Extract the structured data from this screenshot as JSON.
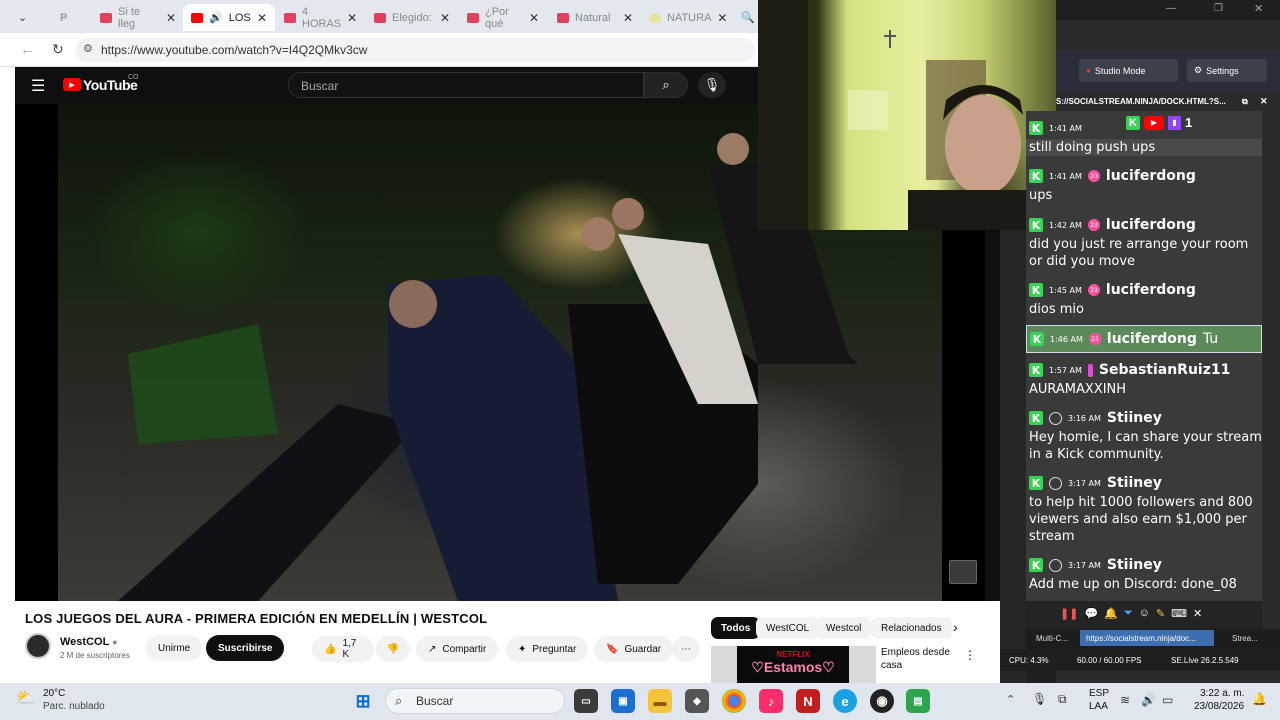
{
  "browser": {
    "tabs": [
      {
        "label": "P",
        "active": false
      },
      {
        "label": "Si te lleg",
        "active": false
      },
      {
        "label": "LOS ",
        "active": true
      },
      {
        "label": "4 HORAS",
        "active": false
      },
      {
        "label": "Elegido:",
        "active": false
      },
      {
        "label": "¿Por qué",
        "active": false
      },
      {
        "label": "Natural",
        "active": false
      },
      {
        "label": "NATURA",
        "active": false
      }
    ],
    "url": "https://www.youtube.com/watch?v=I4Q2QMkv3cw"
  },
  "youtube": {
    "logo": "YouTube",
    "region": "CO",
    "search_placeholder": "Buscar",
    "video_title": "LOS JUEGOS DEL AURA - PRIMERA EDICIÓN EN MEDELLÍN | WESTCOL",
    "channel": "WestCOL",
    "subscribers": "2 M de suscriptores",
    "join_label": "Unirme",
    "subscribe_label": "Suscribirse",
    "likes": "1,7 K",
    "share_label": "Compartir",
    "ask_label": "Preguntar",
    "save_label": "Guardar",
    "more_label": "⋯",
    "chips": [
      "Todos",
      "WestCOL",
      "Westcol",
      "Relacionados"
    ],
    "recommended": {
      "thumb_text_1": "NETFLIX",
      "thumb_text_2": "♡Estamos♡",
      "title": "Empleos desde casa"
    }
  },
  "obs": {
    "studio_mode_label": "Studio Mode",
    "settings_label": "Settings",
    "dock_url": "S://SOCIALSTREAM.NINJA/DOCK.HTML?S...",
    "header_count": "1",
    "chat": [
      {
        "time": "1:41 AM",
        "user": "",
        "text": "still doing push ups"
      },
      {
        "time": "1:41 AM",
        "user": "luciferdong",
        "text": "ups"
      },
      {
        "time": "1:42 AM",
        "user": "luciferdong",
        "text": "did you just re arrange your room or did you move"
      },
      {
        "time": "1:45 AM",
        "user": "luciferdong",
        "text": "dios mio"
      },
      {
        "time": "1:46 AM",
        "user": "luciferdong",
        "text": "Tu"
      },
      {
        "time": "1:57 AM",
        "user": "SebastianRuiz11",
        "text": "AURAMAXXINH"
      },
      {
        "time": "3:16 AM",
        "user": "Stiiney",
        "text": "Hey homie, I can share your stream in a Kick community."
      },
      {
        "time": "3:17 AM",
        "user": "Stiiney",
        "text": "to help hit 1000 followers and 800 viewers and also earn $1,000 per stream"
      },
      {
        "time": "3:17 AM",
        "user": "Stiiney",
        "text": "Add me up on Discord: done_08"
      }
    ],
    "badge_23": "23",
    "bottom_tabs": [
      "Multi-C...",
      "https://socialstream.ninja/doc...",
      "Strea..."
    ],
    "status": {
      "cpu": "CPU: 4.3%",
      "fps": "60.00 / 60.00 FPS",
      "live": "SE.Live 26.2.5.549"
    }
  },
  "taskbar": {
    "weather_temp": "20°C",
    "weather_desc": "Parc. nublado",
    "search_label": "Buscar",
    "lang1": "ESP",
    "lang2": "LAA",
    "time": "3:22 a. m.",
    "date": "23/08/2026"
  },
  "colors": {
    "youtube_red": "#ff0000",
    "kick_green": "#39d353",
    "twitch_purple": "#9146ff"
  }
}
